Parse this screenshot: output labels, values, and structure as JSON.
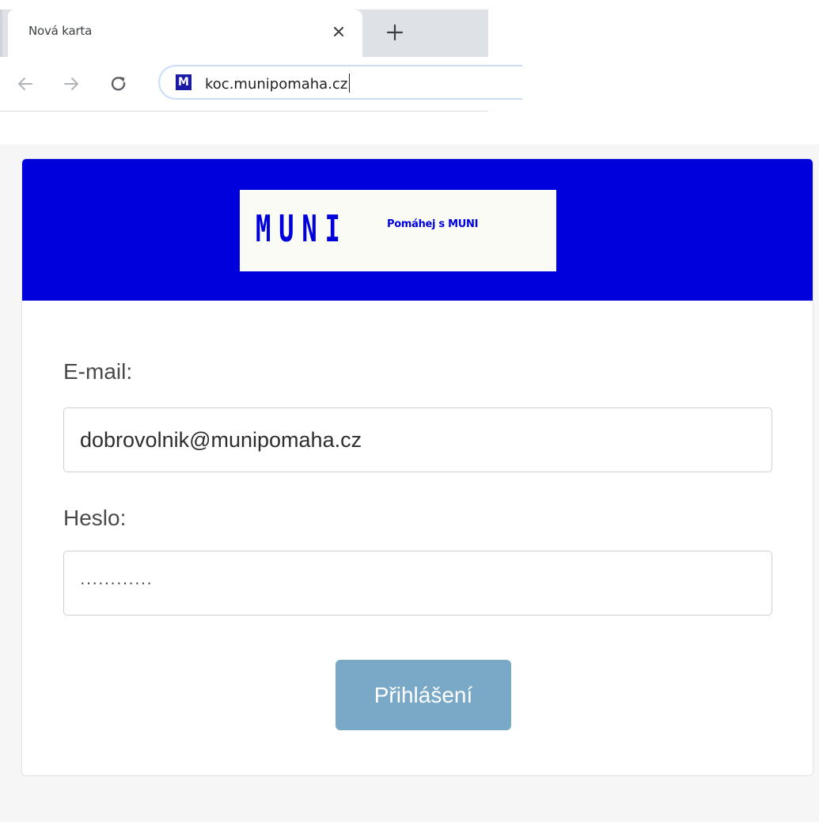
{
  "browser": {
    "tab": {
      "title": "Nová karta",
      "close_glyph": "×"
    },
    "new_tab_glyph": "+",
    "nav": {
      "back_icon": "arrow-left-icon",
      "forward_icon": "arrow-right-icon",
      "reload_icon": "reload-icon"
    },
    "omnibox": {
      "favicon_letter": "M",
      "url": "koc.munipomaha.cz"
    }
  },
  "page": {
    "header": {
      "logo_word": "MUNI",
      "logo_tagline": "Pomáhej s MUNI",
      "background": "#0000dc"
    },
    "form": {
      "email_label": "E-mail:",
      "email_value": "dobrovolnik@munipomaha.cz",
      "password_label": "Heslo:",
      "password_value": "············",
      "submit_label": "Přihlášení",
      "submit_color": "#7aa9c7"
    }
  }
}
